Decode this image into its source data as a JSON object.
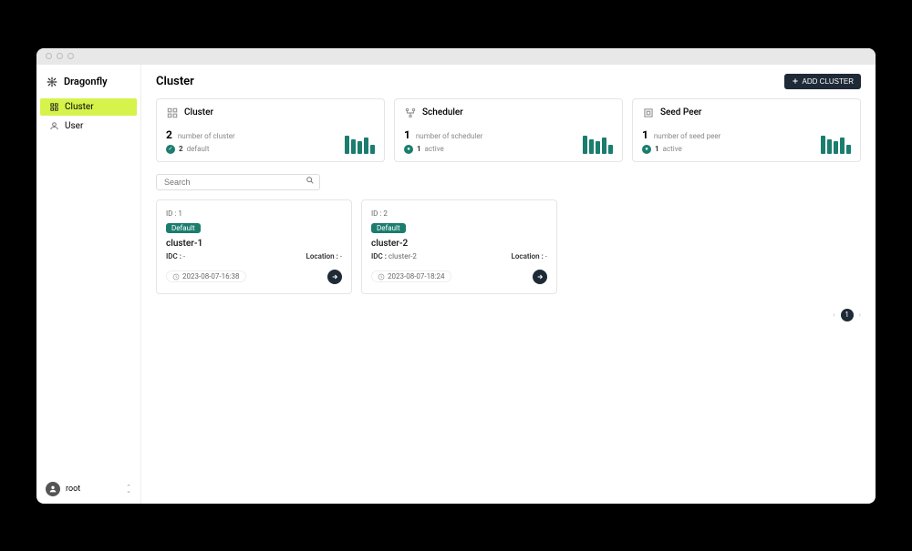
{
  "brand": "Dragonfly",
  "nav": {
    "items": [
      {
        "label": "Cluster",
        "active": true
      },
      {
        "label": "User",
        "active": false
      }
    ]
  },
  "user": {
    "name": "root"
  },
  "page": {
    "title": "Cluster",
    "add_button": "ADD CLUSTER"
  },
  "stats": [
    {
      "title": "Cluster",
      "value": "2",
      "subtitle": "number of cluster",
      "status_value": "2",
      "status_label": "default",
      "bars": [
        20,
        16,
        14,
        18,
        10
      ]
    },
    {
      "title": "Scheduler",
      "value": "1",
      "subtitle": "number of scheduler",
      "status_value": "1",
      "status_label": "active",
      "bars": [
        20,
        16,
        14,
        18,
        10
      ]
    },
    {
      "title": "Seed Peer",
      "value": "1",
      "subtitle": "number of seed peer",
      "status_value": "1",
      "status_label": "active",
      "bars": [
        20,
        16,
        14,
        18,
        10
      ]
    }
  ],
  "search": {
    "placeholder": "Search"
  },
  "clusters": [
    {
      "id_label": "ID : 1",
      "badge": "Default",
      "name": "cluster-1",
      "idc_label": "IDC :",
      "idc_value": "-",
      "loc_label": "Location :",
      "loc_value": "-",
      "timestamp": "2023-08-07-16:38"
    },
    {
      "id_label": "ID : 2",
      "badge": "Default",
      "name": "cluster-2",
      "idc_label": "IDC :",
      "idc_value": "cluster-2",
      "loc_label": "Location :",
      "loc_value": "-",
      "timestamp": "2023-08-07-18:24"
    }
  ],
  "pagination": {
    "current": "1"
  }
}
